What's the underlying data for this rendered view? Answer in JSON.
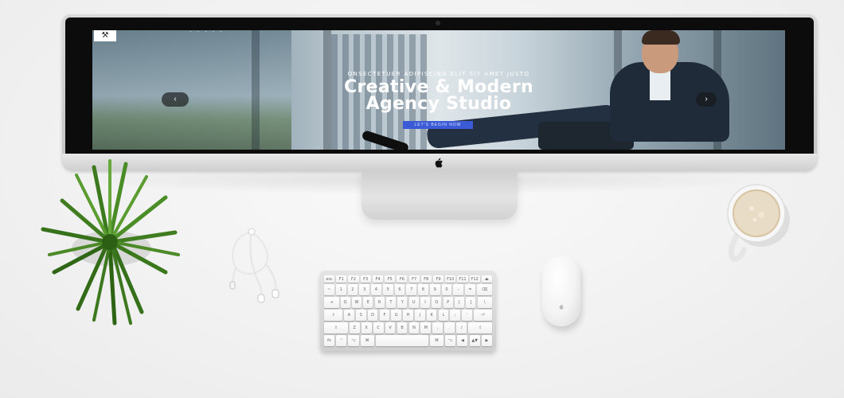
{
  "website": {
    "logo_glyph": "⚒",
    "nav_hint": "· · · · ·",
    "hero": {
      "subtitle": "ONSECTETUER ADIPISCING ELIT SIT AMET JUSTO",
      "title_line1": "Creative & Modern",
      "title_line2": "Agency Studio",
      "cta_label": "LET'S BEGIN NOW"
    },
    "slider": {
      "prev_arrow": "‹",
      "next_arrow": "›"
    },
    "colors": {
      "cta": "#3b5bd6",
      "hero_text": "#ffffff"
    }
  },
  "keyboard": {
    "rows": [
      [
        "esc",
        "F1",
        "F2",
        "F3",
        "F4",
        "F5",
        "F6",
        "F7",
        "F8",
        "F9",
        "F10",
        "F11",
        "F12",
        "⏏"
      ],
      [
        "~",
        "1",
        "2",
        "3",
        "4",
        "5",
        "6",
        "7",
        "8",
        "9",
        "0",
        "-",
        "=",
        "⌫"
      ],
      [
        "⇥",
        "Q",
        "W",
        "E",
        "R",
        "T",
        "Y",
        "U",
        "I",
        "O",
        "P",
        "[",
        "]",
        "\\"
      ],
      [
        "⇪",
        "A",
        "S",
        "D",
        "F",
        "G",
        "H",
        "J",
        "K",
        "L",
        ";",
        "'",
        "⏎"
      ],
      [
        "⇧",
        "Z",
        "X",
        "C",
        "V",
        "B",
        "N",
        "M",
        ",",
        ".",
        "/",
        "⇧"
      ],
      [
        "fn",
        "⌃",
        "⌥",
        "⌘",
        "",
        "⌘",
        "⌥",
        "◀",
        "▲▼",
        "▶"
      ]
    ]
  },
  "icons": {
    "apple": "apple-icon",
    "slider_prev": "chevron-left-icon",
    "slider_next": "chevron-right-icon"
  }
}
